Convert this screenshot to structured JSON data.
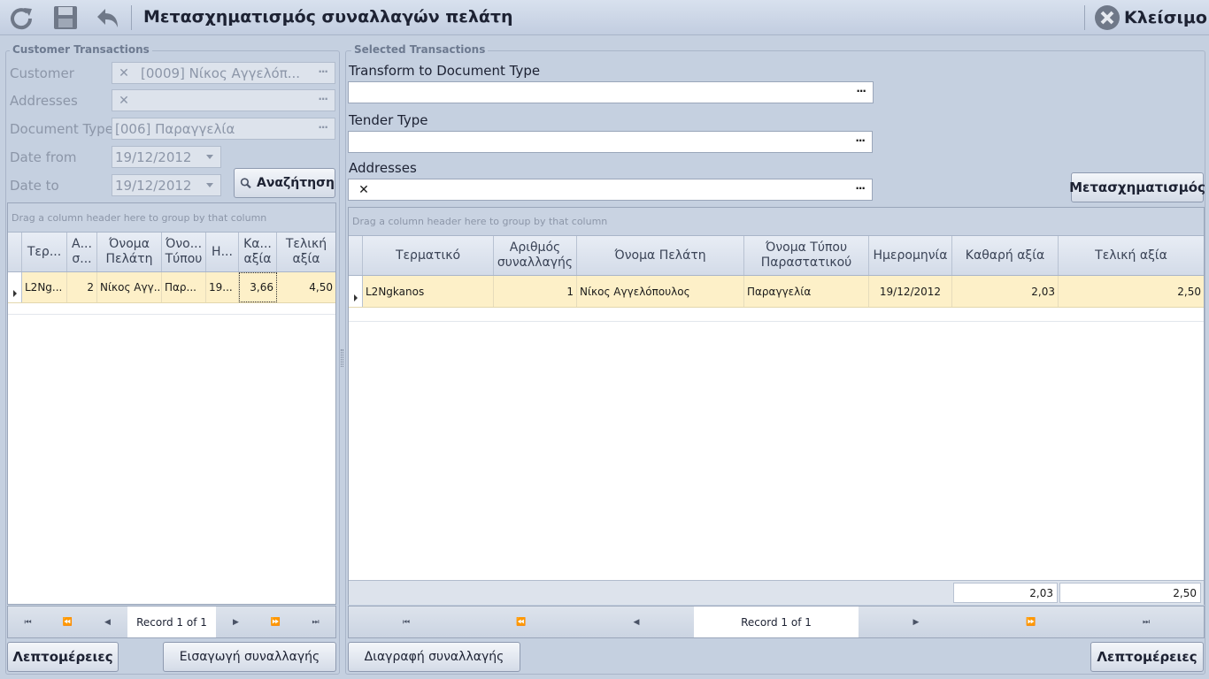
{
  "window": {
    "title": "Μετασχηματισμός συναλλαγών πελάτη",
    "close_label": "Κλείσιμο",
    "toolbar_icons": [
      "refresh-icon",
      "save-icon",
      "undo-icon"
    ]
  },
  "left": {
    "group_title": "Customer Transactions",
    "customer_label": "Customer",
    "customer_value": "[0009] Νίκος Αγγελόπ...",
    "addresses_label": "Addresses",
    "addresses_value": "",
    "doctype_label": "Document Type",
    "doctype_value": "[006] Παραγγελία",
    "date_from_label": "Date from",
    "date_from_value": "19/12/2012",
    "date_to_label": "Date to",
    "date_to_value": "19/12/2012",
    "search_label": "Αναζήτηση",
    "group_panel_text": "Drag a column header here to group by that column",
    "columns": [
      "Τερ...",
      "Α... σ...",
      "Όνομα Πελάτη",
      "Όνο... Τύπου",
      "Η...",
      "Κα... αξία",
      "Τελική αξία"
    ],
    "rows": [
      [
        "L2Ng...",
        "2",
        "Νίκος Αγγ...",
        "Παρ...",
        "19...",
        "3,66",
        "4,50"
      ]
    ],
    "navigator_record": "Record 1 of 1",
    "details_label": "Λεπτομέρειες",
    "insert_label": "Εισαγωγή συναλλαγής"
  },
  "right": {
    "group_title": "Selected Transactions",
    "transform_label": "Transform to Document Type",
    "transform_value": "",
    "tender_label": "Tender Type",
    "tender_value": "",
    "addresses_label": "Addresses",
    "addresses_value": "",
    "transform_button": "Μετασχηματισμός",
    "group_panel_text": "Drag a column header here to group by that column",
    "columns": [
      "Τερματικό",
      "Αριθμός συναλλαγής",
      "Όνομα Πελάτη",
      "Όνομα Τύπου Παραστατικού",
      "Ημερομηνία",
      "Καθαρή αξία",
      "Τελική αξία"
    ],
    "rows": [
      [
        "L2Ngkanos",
        "1",
        "Νίκος Αγγελόπουλος",
        "Παραγγελία",
        "19/12/2012",
        "2,03",
        "2,50"
      ]
    ],
    "footer_net": "2,03",
    "footer_total": "2,50",
    "navigator_record": "Record 1 of 1",
    "delete_label": "Διαγραφή συναλλαγής",
    "details_label": "Λεπτομέρειες"
  },
  "colors": {
    "background": "#c5d0e0",
    "row_highlight": "#fdf0c8",
    "title_text": "#1d2233",
    "disabled_text": "#8c96a8"
  }
}
